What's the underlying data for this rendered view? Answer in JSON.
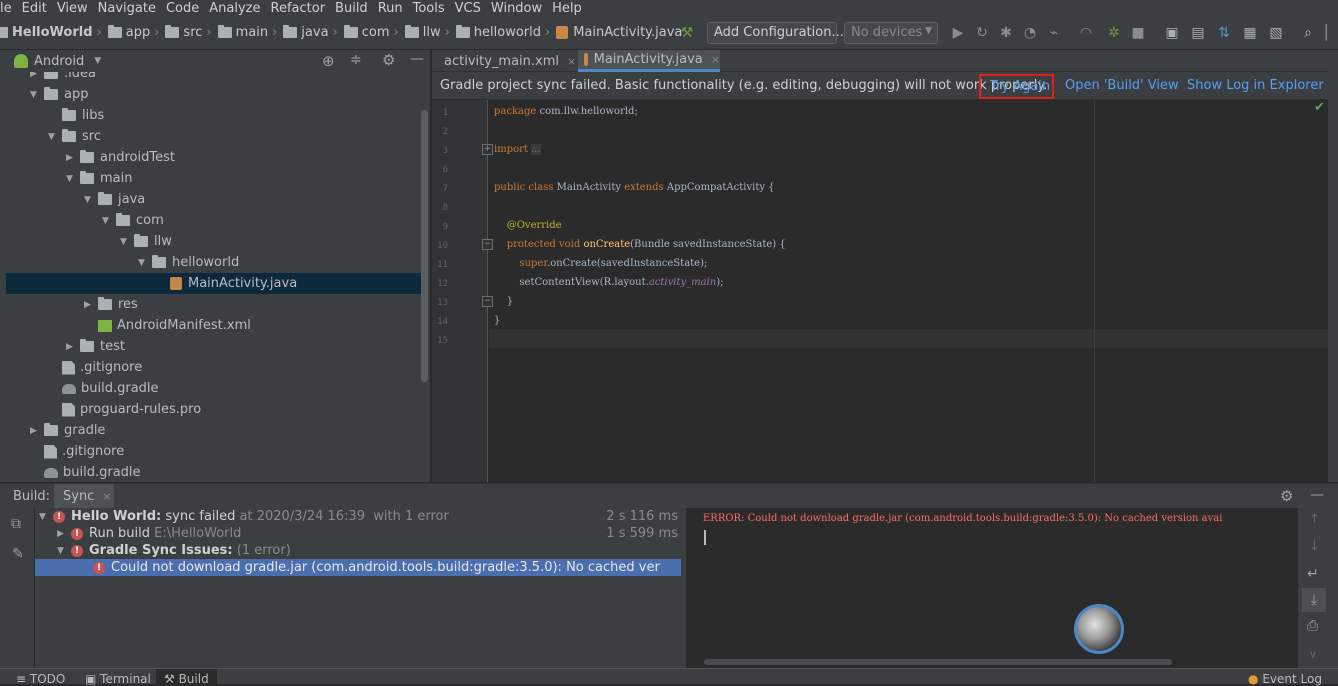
{
  "menu": [
    "le",
    "Edit",
    "View",
    "Navigate",
    "Code",
    "Analyze",
    "Refactor",
    "Build",
    "Run",
    "Tools",
    "VCS",
    "Window",
    "Help"
  ],
  "breadcrumb": {
    "project": "HelloWorld",
    "items": [
      "app",
      "src",
      "main",
      "java",
      "com",
      "llw",
      "helloworld"
    ],
    "file": "MainActivity.java"
  },
  "toolbar": {
    "config_label": "Add Configuration...",
    "devices_label": "No devices"
  },
  "project_panel": {
    "title": "Android"
  },
  "tree": [
    {
      "label": ".idea",
      "depth": 1,
      "arrow": "right",
      "icon": "folder"
    },
    {
      "label": "app",
      "depth": 1,
      "arrow": "down",
      "icon": "folder"
    },
    {
      "label": "libs",
      "depth": 2,
      "arrow": "",
      "icon": "folder"
    },
    {
      "label": "src",
      "depth": 2,
      "arrow": "down",
      "icon": "folder"
    },
    {
      "label": "androidTest",
      "depth": 3,
      "arrow": "right",
      "icon": "folder"
    },
    {
      "label": "main",
      "depth": 3,
      "arrow": "down",
      "icon": "folder"
    },
    {
      "label": "java",
      "depth": 4,
      "arrow": "down",
      "icon": "folder"
    },
    {
      "label": "com",
      "depth": 5,
      "arrow": "down",
      "icon": "folder"
    },
    {
      "label": "llw",
      "depth": 6,
      "arrow": "down",
      "icon": "folder"
    },
    {
      "label": "helloworld",
      "depth": 7,
      "arrow": "down",
      "icon": "folder"
    },
    {
      "label": "MainActivity.java",
      "depth": 8,
      "arrow": "",
      "icon": "java",
      "selected": true
    },
    {
      "label": "res",
      "depth": 4,
      "arrow": "right",
      "icon": "folder"
    },
    {
      "label": "AndroidManifest.xml",
      "depth": 4,
      "arrow": "",
      "icon": "xml"
    },
    {
      "label": "test",
      "depth": 3,
      "arrow": "right",
      "icon": "folder"
    },
    {
      "label": ".gitignore",
      "depth": 2,
      "arrow": "",
      "icon": "file"
    },
    {
      "label": "build.gradle",
      "depth": 2,
      "arrow": "",
      "icon": "gradle"
    },
    {
      "label": "proguard-rules.pro",
      "depth": 2,
      "arrow": "",
      "icon": "file"
    },
    {
      "label": "gradle",
      "depth": 1,
      "arrow": "right",
      "icon": "folder"
    },
    {
      "label": ".gitignore",
      "depth": 1,
      "arrow": "",
      "icon": "file"
    },
    {
      "label": "build.gradle",
      "depth": 1,
      "arrow": "",
      "icon": "gradle"
    }
  ],
  "editor_tabs": [
    {
      "label": "activity_main.xml",
      "active": false
    },
    {
      "label": "MainActivity.java",
      "active": true
    }
  ],
  "banner": {
    "message": "Gradle project sync failed. Basic functionality (e.g. editing, debugging) will not work properly.",
    "try_again": "Try Again",
    "open_build": "Open 'Build' View",
    "show_log": "Show Log in Explorer"
  },
  "code_lines": [
    {
      "n": "1",
      "html": "<span class=\"kw\">package</span> com.llw.helloworld;"
    },
    {
      "n": "2",
      "html": ""
    },
    {
      "n": "3",
      "html": "<span class=\"kw\">import</span> <span style=\"background:#3b3b3b;color:#808080\">...</span>"
    },
    {
      "n": "6",
      "html": ""
    },
    {
      "n": "7",
      "html": "<span class=\"kw\">public class</span> MainActivity <span class=\"kw\">extends</span> AppCompatActivity {"
    },
    {
      "n": "8",
      "html": ""
    },
    {
      "n": "9",
      "html": "    <span class=\"ann\">@Override</span>"
    },
    {
      "n": "10",
      "html": "    <span class=\"kw\">protected void</span> <span style=\"color:#ffc66d\">onCreate</span>(Bundle savedInstanceState) {"
    },
    {
      "n": "11",
      "html": "        <span class=\"kw\">super</span>.onCreate(savedInstanceState);"
    },
    {
      "n": "12",
      "html": "        setContentView(R.layout.<span style=\"color:#9876aa;font-style:italic\">activity_main</span>);"
    },
    {
      "n": "13",
      "html": "    }"
    },
    {
      "n": "14",
      "html": "}"
    },
    {
      "n": "15",
      "html": ""
    }
  ],
  "build_panel": {
    "label": "Build:",
    "tab": "Sync",
    "rows": [
      {
        "title": "Hello World:",
        "detail": "sync failed",
        "meta": "at 2020/3/24 16:39",
        "extra": "with 1 error",
        "time": "2 s 116 ms"
      },
      {
        "title": "Run build",
        "detail": "E:\\HelloWorld",
        "time": "1 s 599 ms"
      },
      {
        "title": "Gradle Sync Issues:",
        "detail": "(1 error)"
      },
      {
        "title": "Could not download gradle.jar (com.android.tools.build:gradle:3.5.0): No cached ver"
      }
    ],
    "console_error": "ERROR: Could not download gradle.jar (com.android.tools.build:gradle:3.5.0): No cached version avai"
  },
  "statusbar": {
    "todo": "TODO",
    "terminal": "Terminal",
    "build": "Build",
    "event_log": "Event Log"
  }
}
